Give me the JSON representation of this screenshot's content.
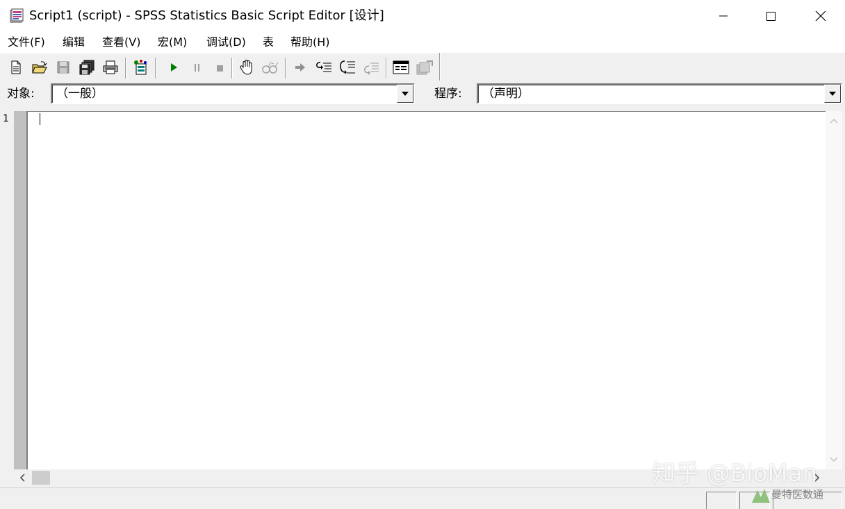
{
  "window": {
    "title": "Script1 (script) - SPSS Statistics Basic Script Editor [设计]"
  },
  "menu": {
    "items": [
      {
        "label": "文件(F)"
      },
      {
        "label": "编辑"
      },
      {
        "label": "查看(V)"
      },
      {
        "label": "宏(M)"
      },
      {
        "label": "调试(D)"
      },
      {
        "label": "表"
      },
      {
        "label": "帮助(H)"
      }
    ]
  },
  "toolbar": {
    "icons": [
      "new-file-icon",
      "open-folder-icon",
      "save-icon",
      "save-all-icon",
      "print-icon",
      "dialog-editor-icon",
      "run-icon",
      "pause-icon",
      "stop-icon",
      "toggle-breakpoint-icon",
      "quick-watch-icon",
      "step-into-icon",
      "step-over-icon",
      "step-out-icon",
      "step-to-cursor-icon",
      "object-browser-icon",
      "references-icon"
    ]
  },
  "object_row": {
    "object_label": "对象:",
    "object_value": "（一般）",
    "procedure_label": "程序:",
    "procedure_value": "（声明）"
  },
  "editor": {
    "line_number": "1",
    "content": ""
  },
  "watermark": {
    "text": "知乎 @BioMan",
    "secondary": "曼特医数通"
  },
  "colors": {
    "chrome": "#f0f0f0",
    "run_green": "#008000",
    "disabled_gray": "#a0a0a0"
  }
}
